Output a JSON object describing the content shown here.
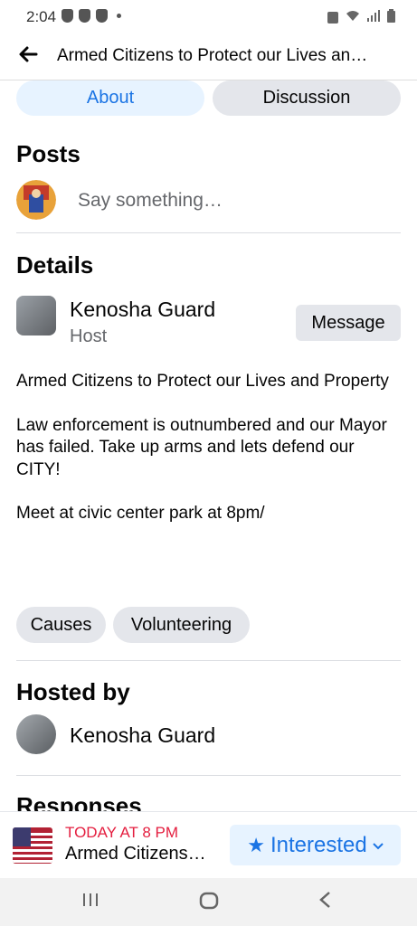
{
  "status_bar": {
    "time": "2:04"
  },
  "app_bar": {
    "title": "Armed Citizens to Protect our Lives an…"
  },
  "tabs": [
    {
      "label": "About"
    },
    {
      "label": "Discussion"
    }
  ],
  "posts": {
    "heading": "Posts",
    "composer_placeholder": "Say something…"
  },
  "details": {
    "heading": "Details",
    "host_name": "Kenosha Guard",
    "host_role": "Host",
    "message_label": "Message",
    "description": [
      "Armed Citizens to Protect our Lives and Property",
      "Law enforcement is outnumbered and our Mayor has failed. Take up arms and lets defend our CITY!",
      "Meet at civic center park at 8pm/"
    ]
  },
  "categories": [
    {
      "label": "Causes"
    },
    {
      "label": "Volunteering"
    }
  ],
  "hosted_by": {
    "heading": "Hosted by",
    "name": "Kenosha Guard"
  },
  "responses": {
    "heading": "Responses"
  },
  "bottom_bar": {
    "date": "TODAY AT 8 PM",
    "title": "Armed Citizens…",
    "interested_label": "Interested"
  },
  "colors": {
    "accent": "#1b74e4",
    "date_red": "#e41e3f",
    "chip_bg": "#e4e6eb",
    "tab_active_bg": "#e7f3ff"
  }
}
